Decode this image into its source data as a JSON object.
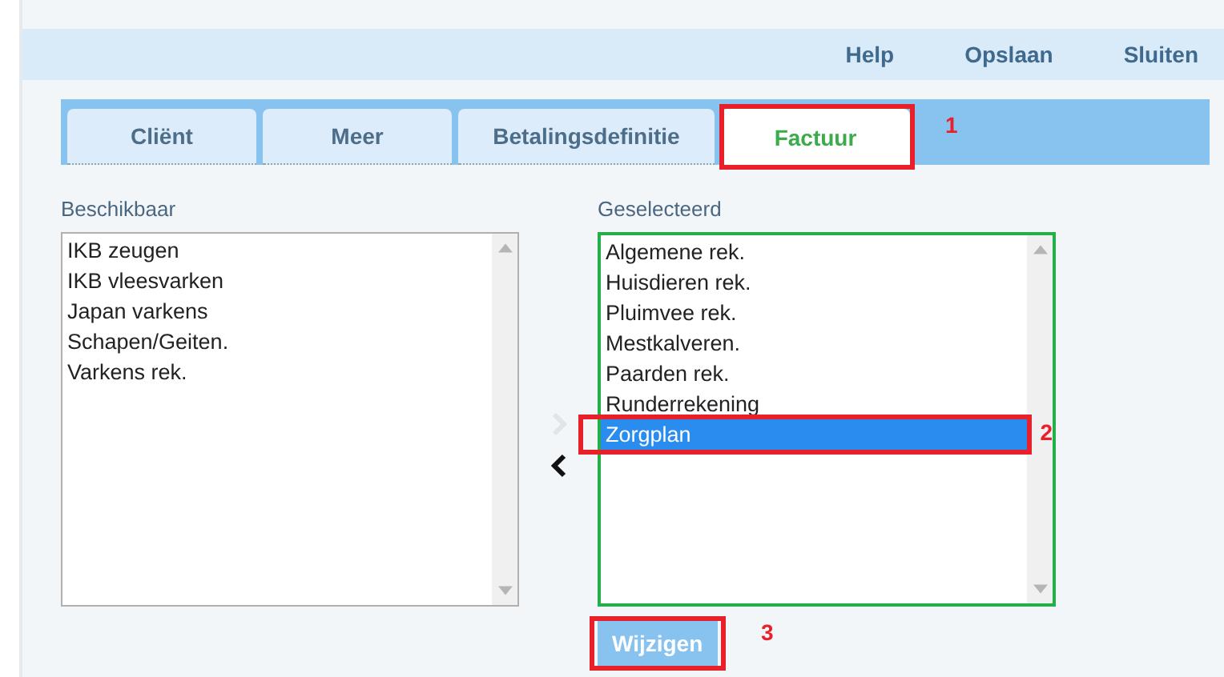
{
  "header_links": [
    {
      "label": "Help"
    },
    {
      "label": "Opslaan"
    },
    {
      "label": "Sluiten"
    }
  ],
  "tabs": [
    {
      "label": "Cliënt",
      "selected": false
    },
    {
      "label": "Meer",
      "selected": false
    },
    {
      "label": "Betalingsdefinitie",
      "selected": false
    },
    {
      "label": "Factuur",
      "selected": true,
      "callout": "1"
    }
  ],
  "available": {
    "label": "Beschikbaar",
    "highlighted": false,
    "items": [
      {
        "label": "IKB zeugen",
        "selected": false
      },
      {
        "label": "IKB vleesvarken",
        "selected": false
      },
      {
        "label": "Japan varkens",
        "selected": false
      },
      {
        "label": "Schapen/Geiten.",
        "selected": false
      },
      {
        "label": "Varkens rek.",
        "selected": false
      }
    ]
  },
  "move_right": {
    "disabled": true
  },
  "move_left": {
    "disabled": false
  },
  "selected_list": {
    "label": "Geselecteerd",
    "highlighted": true,
    "items": [
      {
        "label": "Algemene rek.",
        "selected": false
      },
      {
        "label": "Huisdieren rek.",
        "selected": false
      },
      {
        "label": "Pluimvee rek.",
        "selected": false
      },
      {
        "label": "Mestkalveren.",
        "selected": false
      },
      {
        "label": "Paarden rek.",
        "selected": false
      },
      {
        "label": "Runderrekening",
        "selected": false
      },
      {
        "label": "Zorgplan",
        "selected": true,
        "callout": "2"
      }
    ]
  },
  "button": {
    "label": "Wijzigen",
    "callout": "3"
  }
}
